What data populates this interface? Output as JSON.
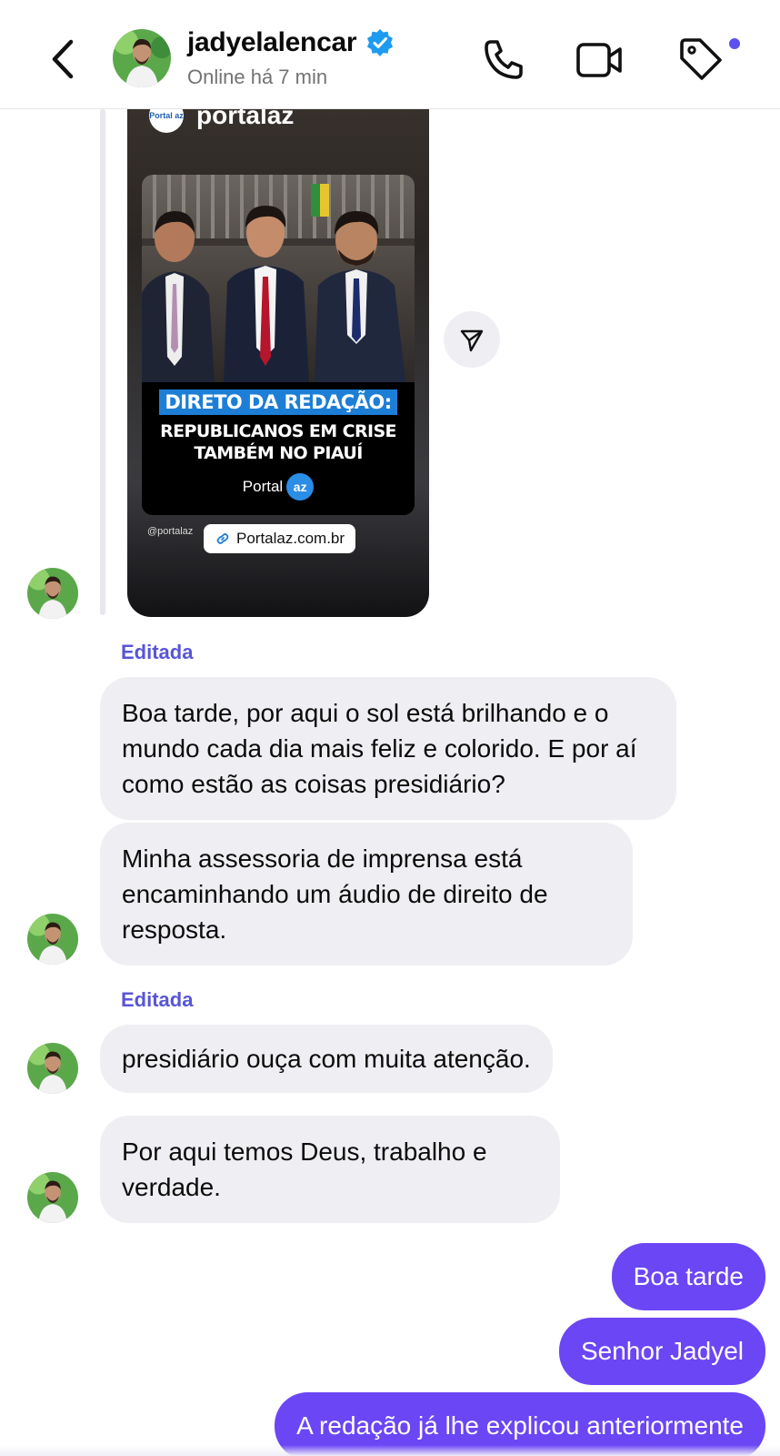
{
  "header": {
    "username": "jadyelalencar",
    "status": "Online há 7 min",
    "accent_color": "#5b51f0",
    "icons": [
      "chevron-left-icon",
      "verified-badge-icon",
      "phone-icon",
      "video-camera-icon",
      "tag-icon"
    ]
  },
  "story": {
    "account": "portalaz",
    "logo_text": "Portal az",
    "headline_tag": "DIRETO DA REDAÇÃO:",
    "headline_line1": "REPUBLICANOS EM CRISE",
    "headline_line2": "TAMBÉM NO PIAUÍ",
    "brand": "Portal",
    "brand_badge": "az",
    "handle": "@portalaz",
    "link": "Portalaz.com.br"
  },
  "messages": {
    "edited_label_1": "Editada",
    "msg1": "Boa tarde, por aqui o sol está brilhando e o mundo cada dia mais feliz e colorido. E por aí como estão as coisas presidiário?",
    "msg2": "Minha assessoria de imprensa está encaminhando um áudio de direito de resposta.",
    "edited_label_2": "Editada",
    "msg3": "presidiário ouça com muita atenção.",
    "msg4": "Por aqui temos Deus, trabalho e verdade.",
    "out1": "Boa tarde",
    "out2": "Senhor Jadyel",
    "out3": "A redação já lhe explicou anteriormente"
  },
  "colors": {
    "outgoing_bubble": "#6b46f5",
    "incoming_bubble": "#efeff3",
    "edited_label": "#5856d6"
  }
}
